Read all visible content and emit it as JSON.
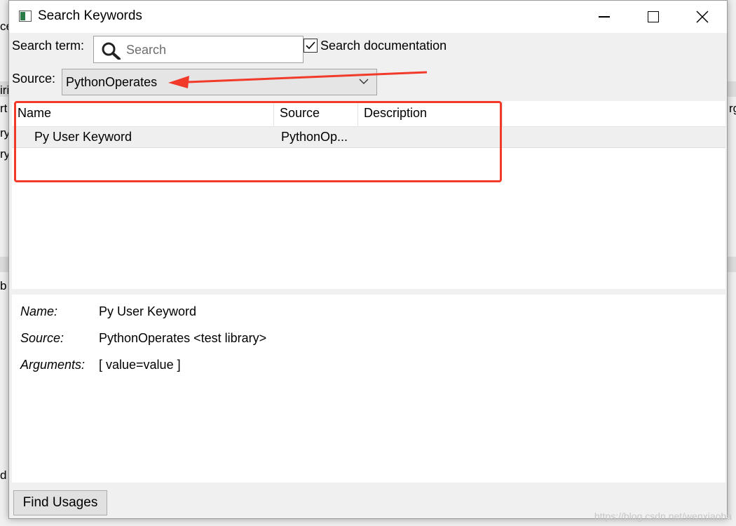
{
  "window": {
    "title": "Search Keywords",
    "controls": {
      "minimize": "minimize-icon",
      "maximize": "maximize-icon",
      "close": "close-icon"
    }
  },
  "search": {
    "label": "Search term:",
    "placeholder": "Search",
    "value": "",
    "doc_checkbox_label": "Search documentation",
    "doc_checkbox_checked": true
  },
  "source": {
    "label": "Source:",
    "selected": "PythonOperates"
  },
  "table": {
    "columns": [
      "Name",
      "Source",
      "Description"
    ],
    "rows": [
      {
        "name": "Py User Keyword",
        "source": "PythonOp...",
        "description": ""
      }
    ]
  },
  "details": {
    "name_key": "Name:",
    "name_value": "Py User Keyword",
    "source_key": "Source:",
    "source_value": "PythonOperates <test library>",
    "arguments_key": "Arguments:",
    "arguments_value": "[ value=value ]"
  },
  "footer": {
    "find_usages_label": "Find Usages"
  },
  "background_fragments": [
    "ce",
    "rt",
    "iri",
    "ry",
    "ry",
    "b",
    "d",
    "rg"
  ],
  "watermark": "https://blog.csdn.net/wenxiaoba",
  "colors": {
    "annotation": "#f23a2a",
    "row_highlight": "#efefef"
  }
}
